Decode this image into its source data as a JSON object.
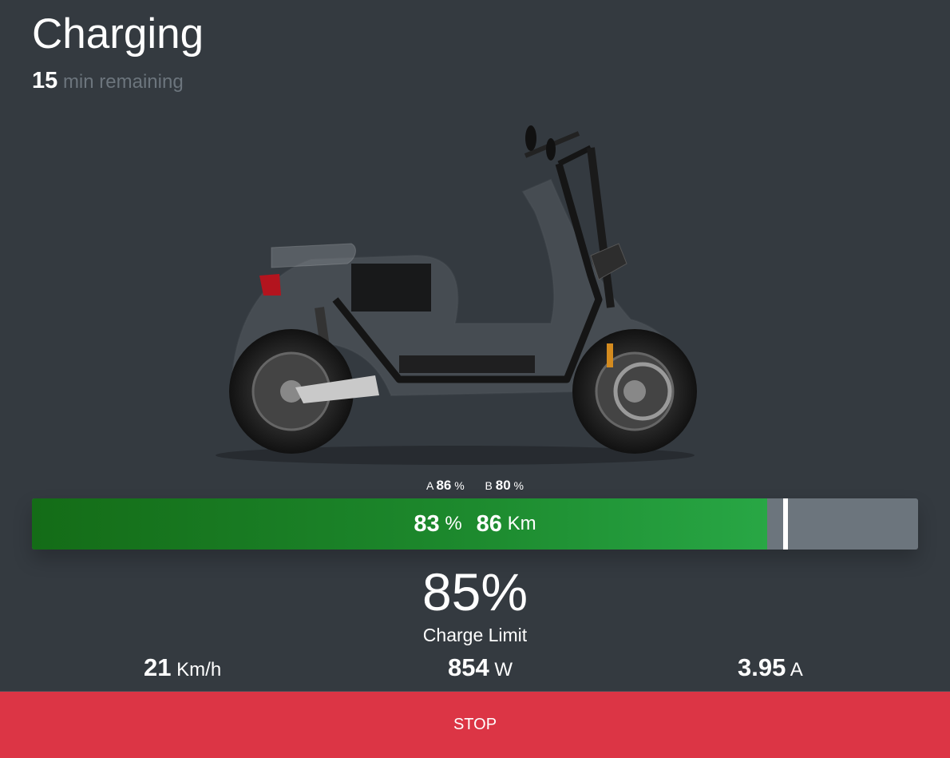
{
  "header": {
    "title": "Charging",
    "time_value": "15",
    "time_label": "min remaining"
  },
  "image": {
    "name": "scooter-image"
  },
  "packs": {
    "a_label": "A",
    "a_value": "86",
    "a_unit": "%",
    "b_label": "B",
    "b_value": "80",
    "b_unit": "%"
  },
  "battery": {
    "percent_value": "83",
    "percent_unit": "%",
    "range_value": "86",
    "range_unit": "Km",
    "fill_level": 0.83,
    "limit_level": 0.85,
    "fill_color": "#28a745",
    "track_color": "#6c757d"
  },
  "charge_limit": {
    "value": "85",
    "unit": "%",
    "label": "Charge Limit"
  },
  "stats": {
    "speed_value": "21",
    "speed_unit": "Km/h",
    "power_value": "854",
    "power_unit": "W",
    "current_value": "3.95",
    "current_unit": "A"
  },
  "actions": {
    "stop_label": "STOP",
    "stop_color": "#dc3545"
  }
}
